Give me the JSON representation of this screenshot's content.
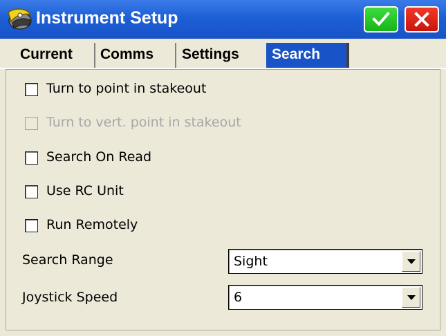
{
  "window": {
    "title": "Instrument Setup"
  },
  "titlebar": {
    "app_icon": "satellite-dish-icon",
    "ok_icon": "checkmark-icon",
    "close_icon": "close-x-icon",
    "ok_color": "#22c322",
    "close_color": "#de2316"
  },
  "tabs": [
    {
      "label": "Current",
      "active": false
    },
    {
      "label": "Comms",
      "active": false
    },
    {
      "label": "Settings",
      "active": false
    },
    {
      "label": "Search",
      "active": true
    }
  ],
  "options": [
    {
      "label": "Turn to point in stakeout",
      "checked": false,
      "enabled": true
    },
    {
      "label": "Turn to vert. point in stakeout",
      "checked": false,
      "enabled": false
    },
    {
      "label": "Search On Read",
      "checked": false,
      "enabled": true
    },
    {
      "label": "Use RC Unit",
      "checked": false,
      "enabled": true
    },
    {
      "label": "Run Remotely",
      "checked": false,
      "enabled": true
    }
  ],
  "fields": {
    "search_range": {
      "label": "Search Range",
      "value": "Sight"
    },
    "joystick_speed": {
      "label": "Joystick Speed",
      "value": "6"
    }
  },
  "colors": {
    "titlebar": "#1853c7",
    "active_tab": "#1853c7",
    "panel_background": "#ece9d8",
    "disabled_text": "#a7a6aa"
  }
}
